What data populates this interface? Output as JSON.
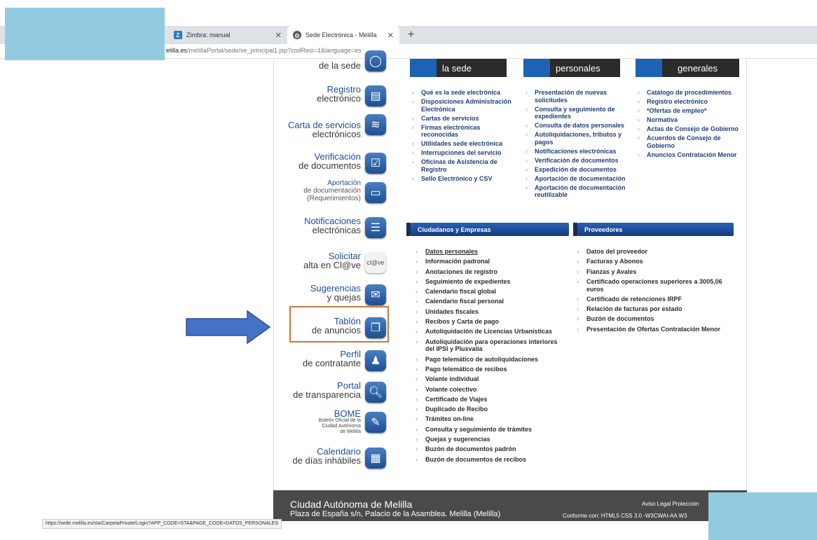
{
  "browser": {
    "tabs": [
      {
        "label": "Zimbra: manual",
        "icon": "zimbra-icon"
      },
      {
        "label": "Sede Electrónica - Melilla",
        "icon": "globe-icon"
      }
    ],
    "url_host": "elilla.es",
    "url_path": "/melillaPortal/sede/se_principal1.jsp?codResi=1&language=es",
    "status_url": "https://sede.melilla.es/sta/CarpetaPrivate/Login?APP_CODE=STA&PAGE_CODE=DATOS_PERSONALES"
  },
  "top_buttons": [
    "la sede",
    "personales",
    "generales"
  ],
  "sidebar": [
    {
      "t1": "",
      "t2": "de la sede",
      "icon": "chat-icon"
    },
    {
      "t1": "Registro",
      "t2": "electrónico",
      "icon": "register-icon"
    },
    {
      "t1": "Carta de servicios",
      "t2": "electrónicos",
      "icon": "stack-icon"
    },
    {
      "t1": "Verificación",
      "t2": "de documentos",
      "icon": "checkbox-icon"
    },
    {
      "t1": "Aportación",
      "t2": "de documentación",
      "t3": "(Requerimientos)",
      "icon": "monitor-icon"
    },
    {
      "t1": "Notificaciones",
      "t2": "electrónicas",
      "icon": "list-icon"
    },
    {
      "t1": "Solicitar",
      "t2": "alta en Cl@ve",
      "icon": "clave-icon",
      "icon_text": "cl@ve"
    },
    {
      "t1": "Sugerencias",
      "t2": "y quejas",
      "icon": "envelope-icon"
    },
    {
      "t1": "Tablón",
      "t2": "de anuncios",
      "icon": "board-icon"
    },
    {
      "t1": "Perfil",
      "t2": "de contratante",
      "icon": "people-icon"
    },
    {
      "t1": "Portal",
      "t2": "de transparencia",
      "icon": "magnifier-icon"
    },
    {
      "t1": "BOME",
      "t2": "Boletín Oficial de la",
      "t3": "Ciudad Autónoma",
      "t4": "de Melilla",
      "icon": "book-icon"
    },
    {
      "t1": "Calendario",
      "t2": "de días inhábiles",
      "icon": "calendar-icon"
    }
  ],
  "col1": [
    "Qué es la sede electrónica",
    "Disposiciones Administración Electrónica",
    "Cartas de servicios",
    "Firmas electrónicas reconocidas",
    "Utilidades sede electrónica",
    "Interrupciones del servicio",
    "Oficinas de Asistencia de Registro",
    "Sello Electrónico y CSV"
  ],
  "col2": [
    "Presentación de nuevas solicitudes",
    "Consulta y seguimiento de expedientes",
    "Consulta de datos personales",
    "Autoliquidaciones, tributos y pagos",
    "Notificaciones electrónicas",
    "Verificación de documentos",
    "Expedición de documentos",
    "Aportación de documentación",
    "Aportación de documentación reutilizable"
  ],
  "col3": [
    "Catálogo de procedimientos",
    "Registro electrónico",
    "*Ofertas de empleo*",
    "Normativa",
    "Actas de Consejo de Gobierno",
    "Acuerdos de Consejo de Gobierno",
    "Anuncios Contratación Menor"
  ],
  "sections": {
    "ciudadanos": "Ciudadanos y Empresas",
    "proveedores": "Proveedores"
  },
  "ciudadanos": [
    "Datos personales",
    "Información padronal",
    "Anotaciones de registro",
    "Seguimiento de expedientes",
    "Calendario fiscal global",
    "Calendario fiscal personal",
    "Unidades fiscales",
    "Recibos y Carta de pago",
    "Autoliquidación de Licencias Urbanísticas",
    "Autoliquidación para operaciones interiores del IPSI y Plusvalía",
    "Pago telemático de autoliquidaciones",
    "Pago telemático de recibos",
    "Volante individual",
    "Volante colectivo",
    "Certificado de Viajes",
    "Duplicado de Recibo",
    "Trámites on-line",
    "Consulta y seguimiento de trámites",
    "Quejas y sugerencias",
    "Buzón de documentos padrón",
    "Buzón de documentos de recibos"
  ],
  "proveedores": [
    "Datos del proveedor",
    "Facturas y Abonos",
    "Fianzas y Avales",
    "Certificado operaciones superiores a 3005,06 euros",
    "Certificado de retenciones IRPF",
    "Relación de facturas por estado",
    "Buzón de documentos",
    "Presentación de Ofertas Contratación Menor"
  ],
  "footer": {
    "title": "Ciudad Autónoma de Melilla",
    "address": "Plaza de España s/n, Palacio de la Asamblea. Melilla (Melilla)",
    "links": "Aviso Legal   Protección",
    "conformance": "Conforme con:  HTML5   CSS 3.0 -W3CWAI-AA   W3"
  },
  "colors": {
    "accent": "#1d4e9a",
    "overlay": "#92cbe0",
    "highlight": "#c77a3a",
    "arrow": "#4472c4"
  }
}
